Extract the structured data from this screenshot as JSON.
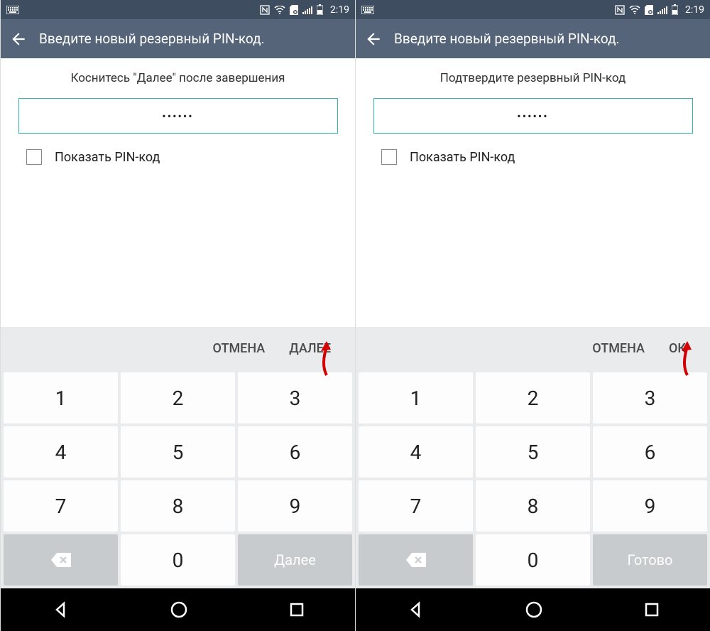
{
  "status": {
    "time": "2:19"
  },
  "screens": [
    {
      "title": "Введите новый резервный PIN-код.",
      "instruction": "Коснитесь \"Далее\" после завершения",
      "pin_masked": "••••••",
      "show_pin_label": "Показать PIN-код",
      "actions": {
        "cancel": "ОТМЕНА",
        "confirm": "ДАЛЕЕ"
      },
      "keypad_done": "Далее",
      "arrow_target": "confirm"
    },
    {
      "title": "Введите новый резервный PIN-код.",
      "instruction": "Подтвердите резервный PIN-код",
      "pin_masked": "••••••",
      "show_pin_label": "Показать PIN-код",
      "actions": {
        "cancel": "ОТМЕНА",
        "confirm": "ОК"
      },
      "keypad_done": "Готово",
      "arrow_target": "confirm"
    }
  ],
  "keypad": {
    "keys": [
      "1",
      "2",
      "3",
      "4",
      "5",
      "6",
      "7",
      "8",
      "9",
      "0"
    ]
  }
}
